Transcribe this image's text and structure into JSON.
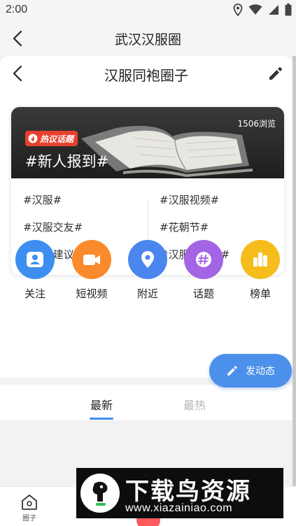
{
  "status_bar": {
    "time": "2:00"
  },
  "outer_header": {
    "title": "武汉汉服圈"
  },
  "inner_header": {
    "title": "汉服同袍圈子"
  },
  "topic_card": {
    "badge": "热议话题",
    "title": "#新人报到#",
    "views": "1506浏览",
    "tags_left": [
      "#汉服#",
      "#汉服交友#",
      "#平台建议#"
    ],
    "tags_right": [
      "#汉服视频#",
      "#花朝节#",
      "#汉服文化节#"
    ]
  },
  "quick_actions": [
    {
      "label": "关注",
      "icon": "follow-icon",
      "color": "#3d8ef0"
    },
    {
      "label": "短视频",
      "icon": "video-icon",
      "color": "#fb8a2c"
    },
    {
      "label": "附近",
      "icon": "location-icon",
      "color": "#4a86ee"
    },
    {
      "label": "话题",
      "icon": "topic-icon",
      "color": "#a365e6"
    },
    {
      "label": "榜单",
      "icon": "ranking-icon",
      "color": "#f5bc1c"
    }
  ],
  "publish_button": {
    "label": "发动态"
  },
  "feed_tabs": [
    {
      "label": "最新",
      "active": true
    },
    {
      "label": "最热",
      "active": false
    }
  ],
  "bottom_nav": {
    "circle_label": "圈子"
  },
  "watermark": {
    "text": "下载鸟资源",
    "url": "www.xiazainiao.com"
  },
  "colors": {
    "accent": "#3e8ee6",
    "hot_badge": "#e8402e",
    "publish": "#4b90ea"
  }
}
